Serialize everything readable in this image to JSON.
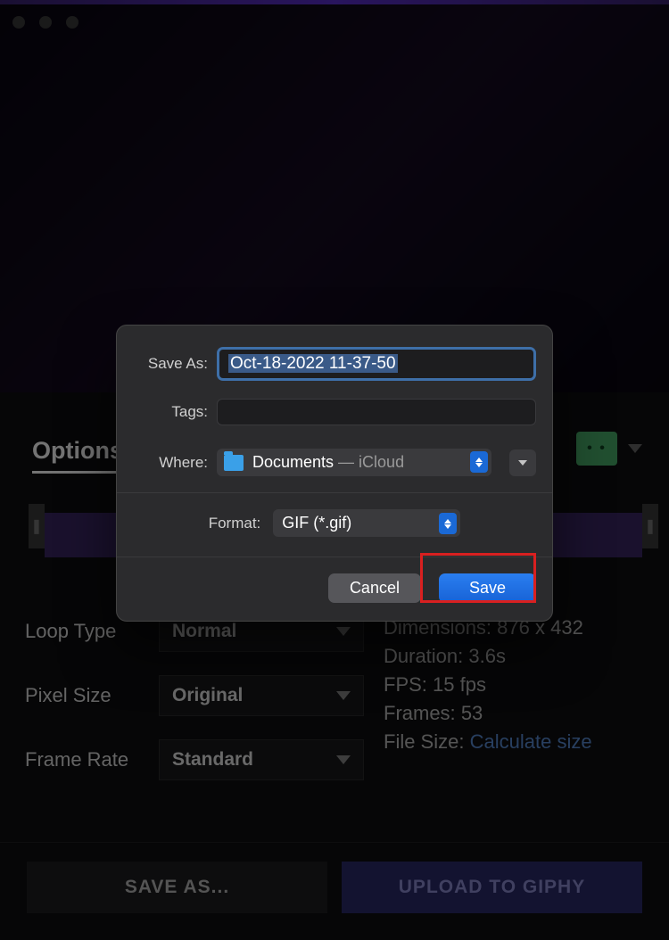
{
  "window": {
    "traffic_lights": [
      "close",
      "minimize",
      "maximize"
    ]
  },
  "tabs": {
    "options_label": "Options"
  },
  "right_chip": {
    "dots": "• •"
  },
  "options": {
    "loop_type": {
      "label": "Loop Type",
      "value": "Normal"
    },
    "pixel_size": {
      "label": "Pixel Size",
      "value": "Original"
    },
    "frame_rate": {
      "label": "Frame Rate",
      "value": "Standard"
    }
  },
  "info": {
    "dimensions_label": "Dimensions:",
    "dimensions_value": "876 x 432",
    "duration_label": "Duration:",
    "duration_value": "3.6s",
    "fps_label": "FPS:",
    "fps_value": "15 fps",
    "frames_label": "Frames:",
    "frames_value": "53",
    "filesize_label": "File Size:",
    "filesize_value": "Calculate size"
  },
  "bottom": {
    "save_as": "SAVE AS...",
    "upload_giphy": "UPLOAD TO GIPHY"
  },
  "dialog": {
    "save_as_label": "Save As:",
    "save_as_value": "Oct-18-2022 11-37-50",
    "tags_label": "Tags:",
    "tags_value": "",
    "where_label": "Where:",
    "where_folder": "Documents",
    "where_suffix": " — iCloud",
    "format_label": "Format:",
    "format_value": "GIF (*.gif)",
    "cancel": "Cancel",
    "save": "Save"
  }
}
